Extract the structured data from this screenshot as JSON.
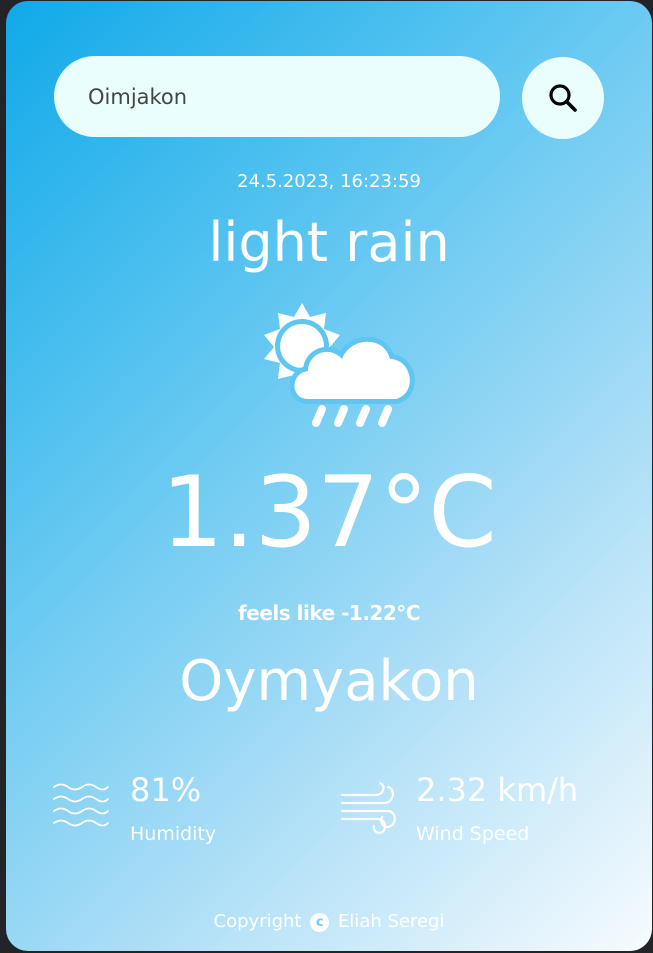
{
  "search": {
    "value": "Oimjakon"
  },
  "weather": {
    "datetime": "24.5.2023, 16:23:59",
    "description": "light rain",
    "icon": "sun-cloud-rain-icon",
    "temperature": "1.37°C",
    "feels_like": "feels like -1.22°C",
    "city": "Oymyakon"
  },
  "stats": {
    "humidity": {
      "value": "81%",
      "label": "Humidity",
      "icon": "waves-icon"
    },
    "wind": {
      "value": "2.32 km/h",
      "label": "Wind Speed",
      "icon": "wind-icon"
    }
  },
  "footer": {
    "prefix": "Copyright",
    "symbol": "c",
    "author": "Eliah Seregi"
  },
  "colors": {
    "gradient_start": "#10a9e9",
    "gradient_end": "#f7fbfe",
    "input_bg": "#eafffd",
    "text": "#ffffff"
  }
}
